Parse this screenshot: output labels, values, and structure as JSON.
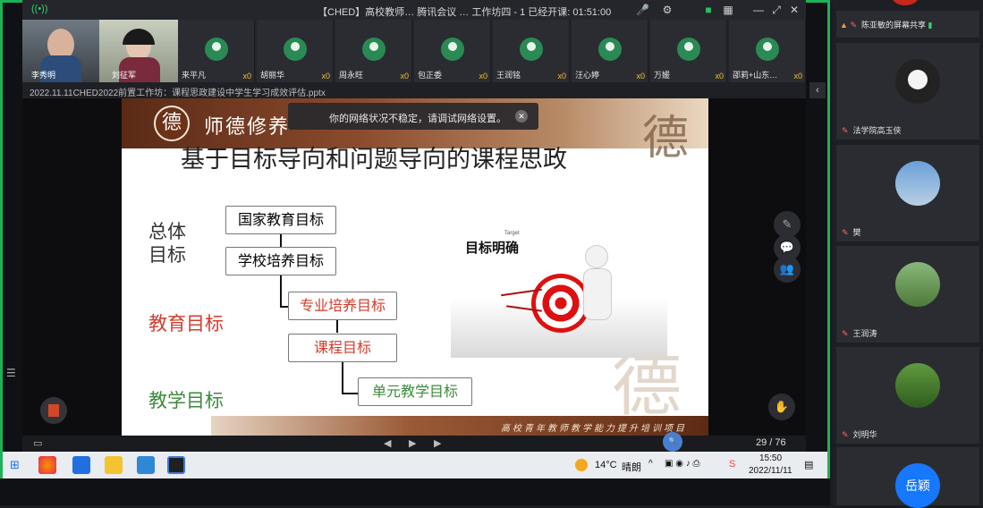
{
  "meeting": {
    "title": "【CHED】高校教师… 腾讯会议 … 工作坊四 - 1   已经开课: 01:51:00",
    "elapsed": "已经开课: 01:51:00"
  },
  "participants_strip": [
    {
      "name": "李秀明",
      "cups": ""
    },
    {
      "name": "刘征军",
      "cups": ""
    },
    {
      "name": "来平凡",
      "cups": "x0"
    },
    {
      "name": "胡丽华",
      "cups": "x0"
    },
    {
      "name": "周永旺",
      "cups": "x0"
    },
    {
      "name": "包正委",
      "cups": "x0"
    },
    {
      "name": "王润铭",
      "cups": "x0"
    },
    {
      "name": "汪心婷",
      "cups": "x0"
    },
    {
      "name": "万媛",
      "cups": "x0"
    },
    {
      "name": "邵莉+山东…",
      "cups": "x0"
    }
  ],
  "file": {
    "name": "2022.11.11CHED2022前置工作坊：课程思政建设中学生学习成效评估.pptx"
  },
  "toast": {
    "message": "你的网络状况不稳定，请调试网络设置。"
  },
  "slide": {
    "banner_text": "师德修养",
    "seal_char": "德",
    "deco_char": "德",
    "title": "基于目标导向和问题导向的课程思政",
    "labels": {
      "overall": "总体\n目标",
      "education": "教育目标",
      "teaching": "教学目标"
    },
    "boxes": [
      "国家教育目标",
      "学校培养目标",
      "专业培养目标",
      "课程目标",
      "单元教学目标"
    ],
    "image_caption": "目标明确",
    "image_small": "Target",
    "footer": "高校青年教师教学能力提升培训项目"
  },
  "pager": {
    "current": "29",
    "total": "76"
  },
  "taskbar": {
    "weather_temp": "14°C",
    "weather_text": "晴朗",
    "time": "15:50",
    "date": "2022/11/11"
  },
  "right_panel": [
    {
      "name": "陈亚敏的屏幕共享",
      "color": "#ffffff"
    },
    {
      "name": "法学院高玉侠",
      "color": "#2a2a2a"
    },
    {
      "name": "樊",
      "color": "#4f88c9"
    },
    {
      "name": "王润涛",
      "color": "#4f8a4a"
    },
    {
      "name": "刘明华",
      "color": "#3f7a2f"
    },
    {
      "name": "岳颖",
      "color": "#1677ff"
    }
  ],
  "colors": {
    "accent_green": "#1bb35a",
    "red_text": "#d23c2c",
    "green_text": "#3c8a3c"
  }
}
